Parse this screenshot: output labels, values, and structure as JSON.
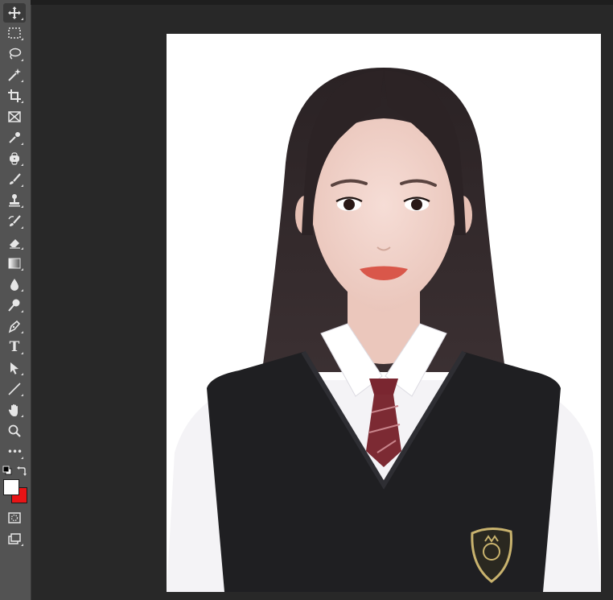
{
  "app": "Photoshop",
  "toolbar": {
    "tools": [
      {
        "name": "move-tool",
        "icon": "move-icon"
      },
      {
        "name": "rectangular-marquee-tool",
        "icon": "marquee-icon"
      },
      {
        "name": "lasso-tool",
        "icon": "lasso-icon"
      },
      {
        "name": "magic-wand-tool",
        "icon": "magic-wand-icon"
      },
      {
        "name": "crop-tool",
        "icon": "crop-icon"
      },
      {
        "name": "frame-tool",
        "icon": "frame-icon"
      },
      {
        "name": "eyedropper-tool",
        "icon": "eyedropper-icon"
      },
      {
        "name": "spot-healing-tool",
        "icon": "healing-icon"
      },
      {
        "name": "brush-tool",
        "icon": "brush-icon"
      },
      {
        "name": "clone-stamp-tool",
        "icon": "stamp-icon"
      },
      {
        "name": "history-brush-tool",
        "icon": "history-brush-icon"
      },
      {
        "name": "eraser-tool",
        "icon": "eraser-icon"
      },
      {
        "name": "gradient-tool",
        "icon": "gradient-icon"
      },
      {
        "name": "blur-tool",
        "icon": "blur-drop-icon"
      },
      {
        "name": "dodge-tool",
        "icon": "dodge-icon"
      },
      {
        "name": "pen-tool",
        "icon": "pen-icon"
      },
      {
        "name": "type-tool",
        "icon": "type-icon",
        "glyph": "T"
      },
      {
        "name": "path-selection-tool",
        "icon": "arrow-cursor-icon"
      },
      {
        "name": "line-tool",
        "icon": "line-icon"
      },
      {
        "name": "hand-tool",
        "icon": "hand-icon"
      },
      {
        "name": "zoom-tool",
        "icon": "zoom-icon"
      },
      {
        "name": "edit-toolbar",
        "icon": "more-icon",
        "glyph": "•••"
      }
    ],
    "foreground_color": "#ffffff",
    "background_color": "#e81416",
    "active_tool": "move-tool"
  },
  "document": {
    "background": "#ffffff",
    "subject": "id-photo-portrait"
  }
}
